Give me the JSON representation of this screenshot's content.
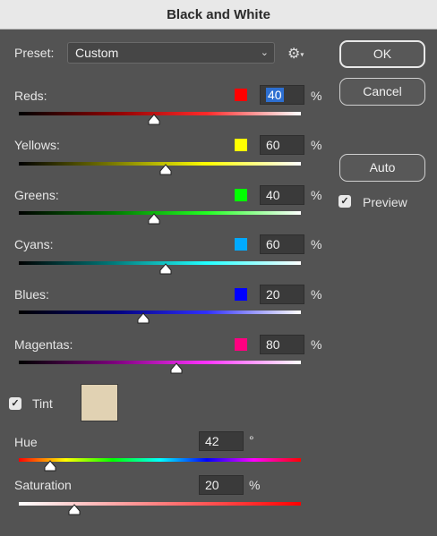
{
  "dialog": {
    "title": "Black and White"
  },
  "preset": {
    "label": "Preset:",
    "value": "Custom"
  },
  "buttons": {
    "ok": "OK",
    "cancel": "Cancel",
    "auto": "Auto"
  },
  "preview": {
    "label": "Preview",
    "checked": true
  },
  "channels": [
    {
      "label": "Reds:",
      "value": "40",
      "unit": "%",
      "color": "#ff0000",
      "fraction": 0.48,
      "gradient": "linear-gradient(to right,#000,#8a0000,#ff2a2a,#ffffff)"
    },
    {
      "label": "Yellows:",
      "value": "60",
      "unit": "%",
      "color": "#ffff00",
      "fraction": 0.52,
      "gradient": "linear-gradient(to right,#000,#7a7a00,#ffff00,#ffffff)"
    },
    {
      "label": "Greens:",
      "value": "40",
      "unit": "%",
      "color": "#00ff00",
      "fraction": 0.48,
      "gradient": "linear-gradient(to right,#000,#007a00,#22ff22,#ffffff)"
    },
    {
      "label": "Cyans:",
      "value": "60",
      "unit": "%",
      "color": "#00aaff",
      "fraction": 0.52,
      "gradient": "linear-gradient(to right,#000,#007a7a,#22ffff,#ffffff)"
    },
    {
      "label": "Blues:",
      "value": "20",
      "unit": "%",
      "color": "#0000ff",
      "fraction": 0.44,
      "gradient": "linear-gradient(to right,#000,#00007a,#3030ff,#ffffff)"
    },
    {
      "label": "Magentas:",
      "value": "80",
      "unit": "%",
      "color": "#ff0080",
      "fraction": 0.56,
      "gradient": "linear-gradient(to right,#000,#7a007a,#ff33ff,#ffffff)"
    }
  ],
  "tint": {
    "label": "Tint",
    "checked": true,
    "color": "#e1d2b3"
  },
  "hue": {
    "label": "Hue",
    "value": "42",
    "unit": "°"
  },
  "saturation": {
    "label": "Saturation",
    "value": "20",
    "unit": "%"
  }
}
